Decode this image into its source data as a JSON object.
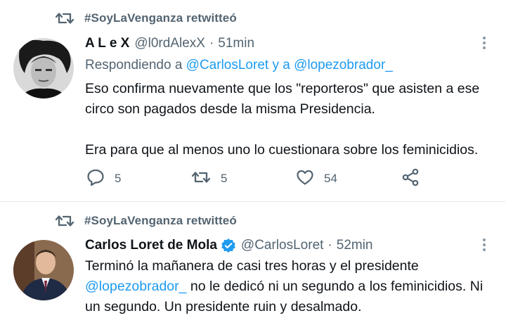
{
  "tweets": [
    {
      "retweeted_by": "#SoyLaVenganza retwitteó",
      "display_name": "A L e X",
      "handle": "@l0rdAlexX",
      "separator": "·",
      "time": "51min",
      "reply_label": "Respondiendo a",
      "reply_mentions": "@CarlosLoret y a @lopezobrador_",
      "paragraphs": [
        "Eso confirma nuevamente que los \"reporteros\" que asisten a ese circo son pagados desde la misma Presidencia.",
        "Era para que al menos uno lo cuestionara sobre los feminicidios."
      ],
      "replies": "5",
      "retweets": "5",
      "likes": "54",
      "verified": false
    },
    {
      "retweeted_by": "#SoyLaVenganza retwitteó",
      "display_name": "Carlos Loret de Mola",
      "handle": "@CarlosLoret",
      "separator": "·",
      "time": "52min",
      "text_start": "Terminó la mañanera de casi tres horas y el presidente",
      "text_mention": "@lopezobrador_",
      "text_end": " no le dedicó ni un segundo a los feminicidios. Ni un segundo. Un presidente ruin y desalmado.",
      "verified": true
    }
  ],
  "icons": {
    "retweet": "retweet-icon",
    "reply": "reply-icon",
    "like": "heart-icon",
    "share": "share-icon",
    "more": "more-vertical-icon",
    "verified": "verified-badge-icon"
  },
  "colors": {
    "accent": "#1d9bf0",
    "secondary_text": "#536471",
    "primary_text": "#0f1419"
  }
}
